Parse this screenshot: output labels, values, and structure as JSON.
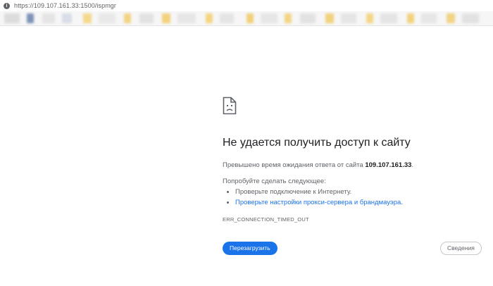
{
  "address_bar": {
    "info_icon": "info-icon",
    "url": "https://109.107.161.33:1500/ispmgr"
  },
  "error": {
    "icon": "sad-document-icon",
    "heading": "Не удается получить доступ к сайту",
    "description_prefix": "Превышено время ожидания ответа от сайта ",
    "host": "109.107.161.33",
    "description_suffix": ".",
    "try_label": "Попробуйте сделать следующее:",
    "suggestions": [
      "Проверьте подключение к Интернету.",
      "Проверьте настройки прокси-сервера и брандмауэра."
    ],
    "code": "ERR_CONNECTION_TIMED_OUT"
  },
  "buttons": {
    "reload": "Перезагрузить",
    "details": "Сведения"
  },
  "colors": {
    "accent": "#1a73e8",
    "text": "#202124",
    "muted": "#5f6368"
  }
}
